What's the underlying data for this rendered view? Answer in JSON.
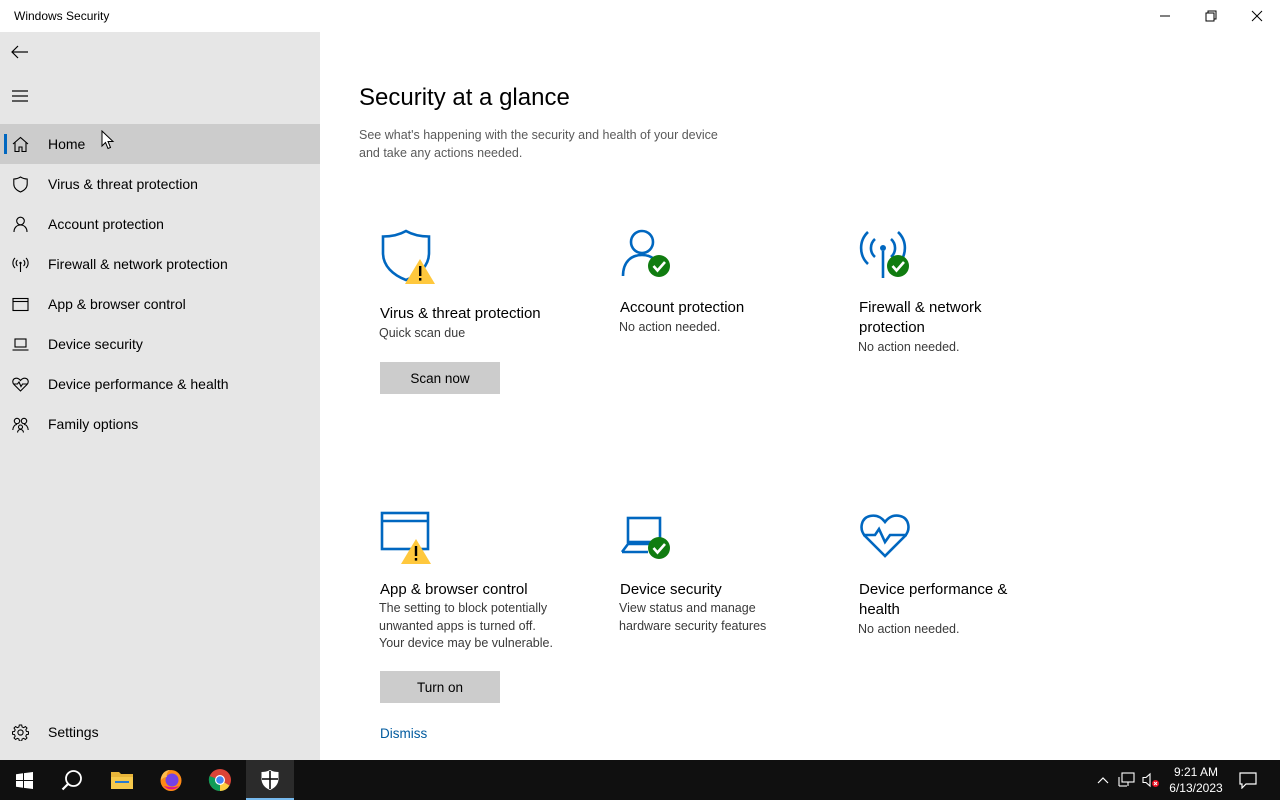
{
  "window": {
    "title": "Windows Security"
  },
  "sidebar": {
    "items": [
      {
        "label": "Home",
        "icon": "home-icon",
        "active": true
      },
      {
        "label": "Virus & threat protection",
        "icon": "shield-icon"
      },
      {
        "label": "Account protection",
        "icon": "person-icon"
      },
      {
        "label": "Firewall & network protection",
        "icon": "antenna-icon"
      },
      {
        "label": "App & browser control",
        "icon": "browser-window-icon"
      },
      {
        "label": "Device security",
        "icon": "laptop-icon"
      },
      {
        "label": "Device performance & health",
        "icon": "heart-icon"
      },
      {
        "label": "Family options",
        "icon": "family-icon"
      }
    ],
    "settings_label": "Settings"
  },
  "main": {
    "title": "Security at a glance",
    "subtitle": "See what's happening with the security and health of your device and take any actions needed.",
    "cards": [
      {
        "title": "Virus & threat protection",
        "desc": "Quick scan due",
        "button": "Scan now",
        "icon": "shield-warning-icon",
        "status": "warning"
      },
      {
        "title": "Account protection",
        "desc": "No action needed.",
        "icon": "person-check-icon",
        "status": "ok"
      },
      {
        "title": "Firewall & network protection",
        "desc": "No action needed.",
        "icon": "antenna-check-icon",
        "status": "ok"
      },
      {
        "title": "App & browser control",
        "desc": "The setting to block potentially unwanted apps is turned off. Your device may be vulnerable.",
        "button": "Turn on",
        "link": "Dismiss",
        "icon": "browser-warning-icon",
        "status": "warning"
      },
      {
        "title": "Device security",
        "desc": "View status and manage hardware security features",
        "icon": "laptop-check-icon",
        "status": "ok"
      },
      {
        "title": "Device performance & health",
        "desc": "No action needed.",
        "icon": "heart-pulse-icon",
        "status": "ok"
      }
    ]
  },
  "taskbar": {
    "apps": [
      "windows-start-icon",
      "search-icon",
      "file-explorer-icon",
      "firefox-icon",
      "chrome-icon",
      "windows-security-icon"
    ],
    "time": "9:21 AM",
    "date": "6/13/2023"
  },
  "colors": {
    "accent": "#0067c0",
    "warning": "#ffc83d",
    "ok": "#107c10",
    "sidebar_bg": "#e6e6e6"
  }
}
